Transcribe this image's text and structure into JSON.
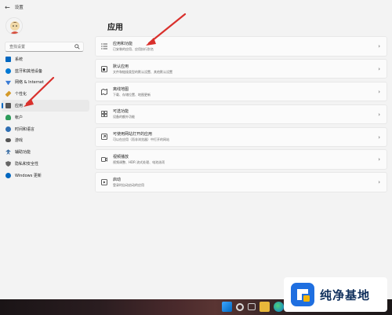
{
  "window": {
    "back_glyph": "←",
    "title": "设置"
  },
  "sidebar": {
    "search_placeholder": "查找设置",
    "items": [
      {
        "label": "系统",
        "icon": "monitor-icon",
        "color": "#0067c0"
      },
      {
        "label": "蓝牙和其他设备",
        "icon": "bluetooth-icon",
        "color": "#0078d4"
      },
      {
        "label": "网络 & Internet",
        "icon": "wifi-icon",
        "color": "#3a7bd5"
      },
      {
        "label": "个性化",
        "icon": "pen-icon",
        "color": "#d49a2a"
      },
      {
        "label": "应用",
        "icon": "apps-icon",
        "color": "#555555",
        "active": true
      },
      {
        "label": "帐户",
        "icon": "person-icon",
        "color": "#2e9c5b"
      },
      {
        "label": "时间和语言",
        "icon": "clock-globe-icon",
        "color": "#2f6fb3"
      },
      {
        "label": "游戏",
        "icon": "gamepad-icon",
        "color": "#555555"
      },
      {
        "label": "辅助功能",
        "icon": "accessibility-icon",
        "color": "#3a6ea5"
      },
      {
        "label": "隐私和安全性",
        "icon": "shield-icon",
        "color": "#666666"
      },
      {
        "label": "Windows 更新",
        "icon": "update-icon",
        "color": "#0067c0"
      }
    ]
  },
  "main": {
    "title": "应用",
    "cards": [
      {
        "title": "应用和功能",
        "subtitle": "已安装的应用、应用执行别名",
        "icon": "list-icon"
      },
      {
        "title": "默认应用",
        "subtitle": "文件和链接类型的默认设置、其他默认设置",
        "icon": "default-apps-icon"
      },
      {
        "title": "离线地图",
        "subtitle": "下载、存储位置、地图更新",
        "icon": "map-icon"
      },
      {
        "title": "可选功能",
        "subtitle": "设备的额外功能",
        "icon": "optional-features-icon"
      },
      {
        "title": "可使用网站打开的应用",
        "subtitle": "可以在应用（而非浏览器）中打开的网站",
        "icon": "website-apps-icon"
      },
      {
        "title": "视频播放",
        "subtitle": "视频调整、HDR 流式处理、电池选项",
        "icon": "video-icon"
      },
      {
        "title": "启动",
        "subtitle": "登录时自动启动的应用",
        "icon": "startup-icon"
      }
    ],
    "chevron": "›"
  },
  "watermark": {
    "text": "纯净基地"
  },
  "colors": {
    "accent": "#0067c0",
    "arrow": "#d9302c"
  }
}
